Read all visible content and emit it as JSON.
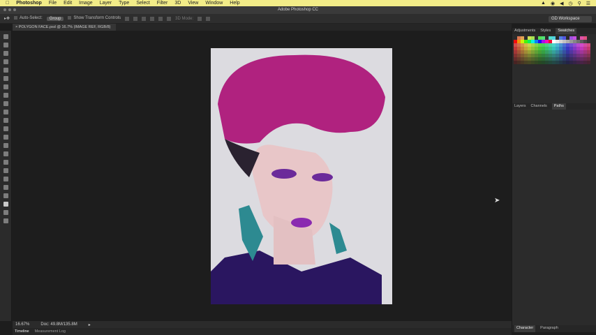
{
  "menubar": {
    "app": "Photoshop",
    "items": [
      "File",
      "Edit",
      "Image",
      "Layer",
      "Type",
      "Select",
      "Filter",
      "3D",
      "View",
      "Window",
      "Help"
    ]
  },
  "window": {
    "title": "Adobe Photoshop CC"
  },
  "options": {
    "auto_select": "Auto-Select:",
    "auto_select_value": "Group",
    "transform": "Show Transform Controls",
    "mode_3d": "3D Mode:",
    "workspace": "GD Workspace"
  },
  "document": {
    "tab": "POLYGON FACE.psd @ 16.7% (IMAGE REF, RGB/8)"
  },
  "panels": {
    "top_tabs": [
      "Adjustments",
      "Styles",
      "Swatches"
    ],
    "mid_tabs": [
      "Layers",
      "Channels",
      "Paths"
    ],
    "bottom_tabs": [
      "Character",
      "Paragraph"
    ]
  },
  "status": {
    "zoom": "16.67%",
    "doc": "Doc: 49.8M/135.8M"
  },
  "bottom": {
    "tabs": [
      "Timeline",
      "Measurement Log"
    ]
  },
  "colors": {
    "menubar": "#f2ec88",
    "hair": "#b0227f",
    "jacket": "#2a1660",
    "earring": "#2d8a91"
  }
}
